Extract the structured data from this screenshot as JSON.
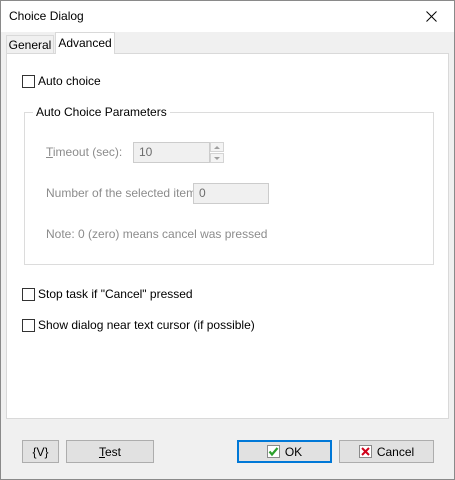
{
  "window": {
    "title": "Choice Dialog"
  },
  "tabs": [
    {
      "label": "General",
      "selected": false
    },
    {
      "label": "Advanced",
      "selected": true
    }
  ],
  "advanced": {
    "auto_choice_label": "Auto choice",
    "auto_choice_checked": false,
    "group_title": "Auto Choice Parameters",
    "timeout_label": "Timeout (sec):",
    "timeout_value": "10",
    "item_label": "Number of the selected item:",
    "item_value": "0",
    "note": "Note: 0 (zero) means cancel was pressed",
    "stop_task_label": "Stop task if \"Cancel\" pressed",
    "stop_task_checked": false,
    "show_near_cursor_label": "Show dialog near text cursor (if possible)",
    "show_near_cursor_checked": false
  },
  "buttons": {
    "variables": "{V}",
    "test": "Test",
    "ok": "OK",
    "cancel": "Cancel"
  },
  "colors": {
    "ok_check": "#2ca02c",
    "cancel_x": "#d0021b",
    "focus_border": "#0078d7"
  }
}
